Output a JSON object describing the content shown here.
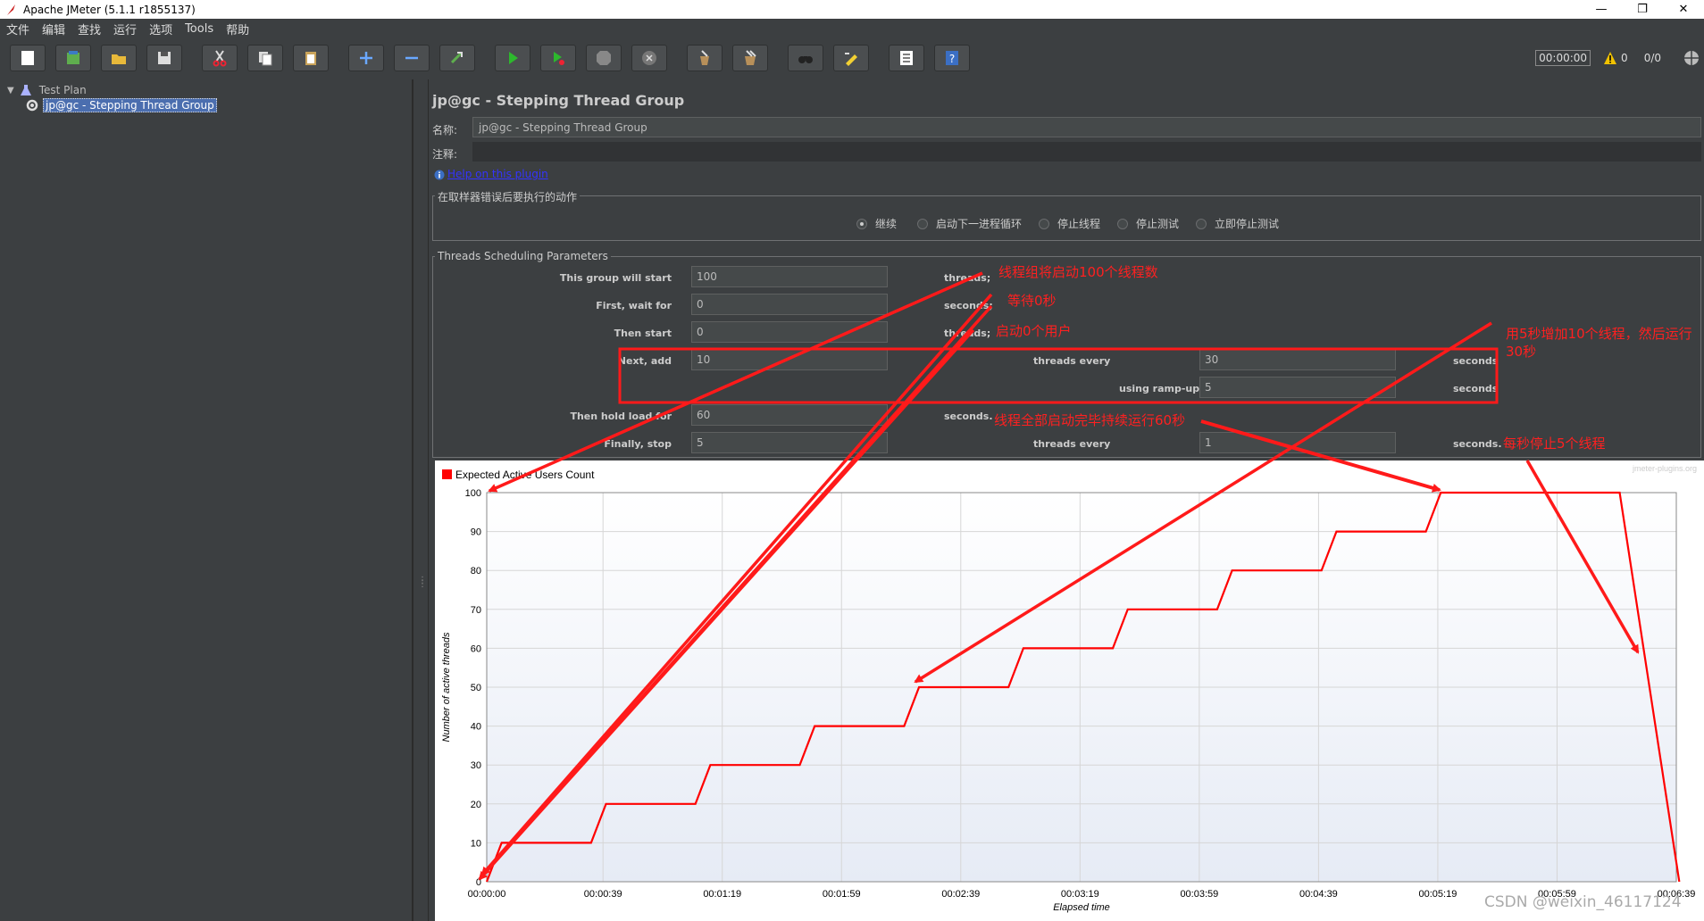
{
  "window": {
    "title": "Apache JMeter (5.1.1 r1855137)",
    "buttons": [
      "—",
      "❐",
      "✕"
    ]
  },
  "menu": [
    "文件",
    "编辑",
    "查找",
    "运行",
    "选项",
    "Tools",
    "帮助"
  ],
  "toolbar": {
    "timer": "00:00:00",
    "warnings": "0",
    "threads_ratio": "0/0",
    "icons": [
      "new-icon",
      "templates-icon",
      "open-icon",
      "save-icon",
      "cut-icon",
      "copy-icon",
      "paste-icon",
      "expand-icon",
      "collapse-icon",
      "toggle-icon",
      "start-icon",
      "start-no-pause-icon",
      "stop-icon",
      "shutdown-icon",
      "clear-icon",
      "clear-all-icon",
      "search-icon",
      "reset-search-icon",
      "function-helper-icon",
      "help-icon"
    ]
  },
  "tree": {
    "root": "Test Plan",
    "child": "jp@gc - Stepping Thread Group"
  },
  "panel": {
    "title": "jp@gc - Stepping Thread Group",
    "name_label": "名称:",
    "name_value": "jp@gc - Stepping Thread Group",
    "comment_label": "注释:",
    "help_link": "Help on this plugin",
    "error_group_title": "在取样器错误后要执行的动作",
    "error_options": [
      {
        "label": "继续",
        "selected": true
      },
      {
        "label": "启动下一进程循环",
        "selected": false
      },
      {
        "label": "停止线程",
        "selected": false
      },
      {
        "label": "停止测试",
        "selected": false
      },
      {
        "label": "立即停止测试",
        "selected": false
      }
    ],
    "params_group_title": "Threads Scheduling Parameters",
    "params": {
      "start_label": "This group will start",
      "start_value": "100",
      "start_unit": "threads;",
      "wait_label": "First, wait for",
      "wait_value": "0",
      "wait_unit": "seconds;",
      "then_start_label": "Then start",
      "then_start_value": "0",
      "then_start_unit": "threads;",
      "next_add_label": "Next, add",
      "next_add_value": "10",
      "threads_every_label": "threads every",
      "threads_every_value": "30",
      "seconds_label": "seconds",
      "rampup_label": "using ramp-up",
      "rampup_value": "5",
      "rampup_unit": "seconds",
      "hold_label": "Then hold load for",
      "hold_value": "60",
      "hold_unit": "seconds.",
      "stop_label": "Finally, stop",
      "stop_value": "5",
      "stop_every_label": "threads every",
      "stop_every_value": "1",
      "stop_unit": "seconds."
    }
  },
  "annotations": {
    "a1": "线程组将启动100个线程数",
    "a2": "等待0秒",
    "a3": "启动0个用户",
    "a4": "用5秒增加10个线程，然后运行30秒",
    "a5": "线程全部启动完毕持续运行60秒",
    "a6": "每秒停止5个线程"
  },
  "chart_data": {
    "type": "line",
    "legend": "Expected Active Users Count",
    "credit": "jmeter-plugins.org",
    "ylabel": "Number of active threads",
    "xlabel": "Elapsed time",
    "ylim": [
      0,
      100
    ],
    "xlim": [
      0,
      399
    ],
    "yticks": [
      0,
      10,
      20,
      30,
      40,
      50,
      60,
      70,
      80,
      90,
      100
    ],
    "xticks": [
      {
        "t": 0,
        "label": "00:00:00"
      },
      {
        "t": 39,
        "label": "00:00:39"
      },
      {
        "t": 79,
        "label": "00:01:19"
      },
      {
        "t": 119,
        "label": "00:01:59"
      },
      {
        "t": 159,
        "label": "00:02:39"
      },
      {
        "t": 199,
        "label": "00:03:19"
      },
      {
        "t": 239,
        "label": "00:03:59"
      },
      {
        "t": 279,
        "label": "00:04:39"
      },
      {
        "t": 319,
        "label": "00:05:19"
      },
      {
        "t": 359,
        "label": "00:05:59"
      },
      {
        "t": 399,
        "label": "00:06:39"
      }
    ],
    "color": "#ff0000",
    "points": [
      [
        0,
        0
      ],
      [
        5,
        10
      ],
      [
        35,
        10
      ],
      [
        40,
        20
      ],
      [
        70,
        20
      ],
      [
        75,
        30
      ],
      [
        105,
        30
      ],
      [
        110,
        40
      ],
      [
        140,
        40
      ],
      [
        145,
        50
      ],
      [
        175,
        50
      ],
      [
        180,
        60
      ],
      [
        210,
        60
      ],
      [
        215,
        70
      ],
      [
        245,
        70
      ],
      [
        250,
        80
      ],
      [
        280,
        80
      ],
      [
        285,
        90
      ],
      [
        315,
        90
      ],
      [
        320,
        100
      ],
      [
        380,
        100
      ],
      [
        381,
        95
      ],
      [
        382,
        90
      ],
      [
        383,
        85
      ],
      [
        384,
        80
      ],
      [
        385,
        75
      ],
      [
        386,
        70
      ],
      [
        387,
        65
      ],
      [
        388,
        60
      ],
      [
        389,
        55
      ],
      [
        390,
        50
      ],
      [
        391,
        45
      ],
      [
        392,
        40
      ],
      [
        393,
        35
      ],
      [
        394,
        30
      ],
      [
        395,
        25
      ],
      [
        396,
        20
      ],
      [
        397,
        15
      ],
      [
        398,
        10
      ],
      [
        399,
        5
      ],
      [
        400,
        0
      ]
    ]
  },
  "watermark": "CSDN @weixin_46117124"
}
